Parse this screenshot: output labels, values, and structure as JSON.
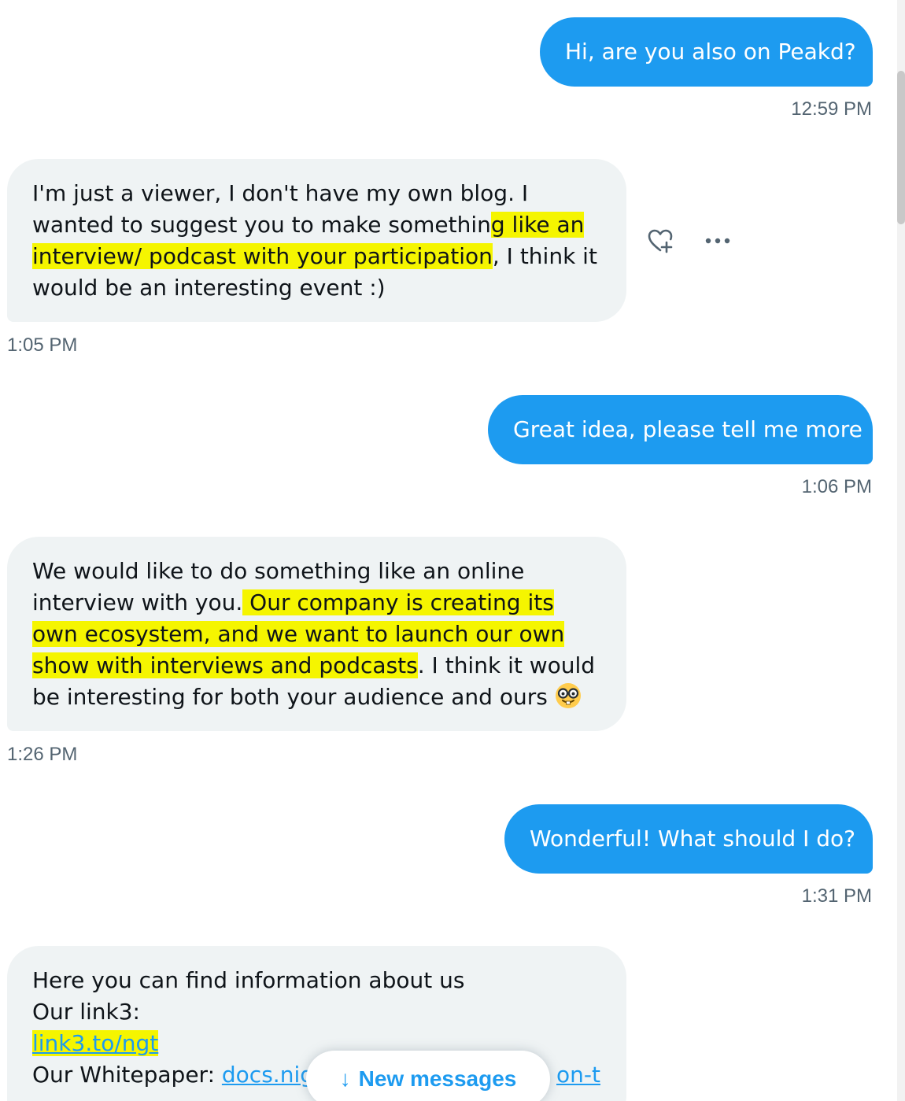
{
  "messages": [
    {
      "type": "sent",
      "text": "Hi, are you also on Peakd?",
      "time": "12:59 PM"
    },
    {
      "type": "received",
      "parts": [
        "I'm just a viewer, I don't have my own blog. I wanted to suggest you to make somethin",
        "g like an interview/ podcast with your participation",
        ", I think it would be an interesting event :)"
      ],
      "time": "1:05 PM"
    },
    {
      "type": "sent",
      "text": "Great idea, please tell me more",
      "time": "1:06 PM"
    },
    {
      "type": "received",
      "parts": [
        "We would like to do something like an online interview with you.",
        " Our company is creating its own ecosystem, and we want to launch our own show with interviews and podcasts",
        ". I think it would be interesting for both your audience and ours"
      ],
      "emoji": "nerd-face-emoji",
      "time": "1:26 PM"
    },
    {
      "type": "sent",
      "text": "Wonderful! What should I do?",
      "time": "1:31 PM"
    },
    {
      "type": "received",
      "line1": "Here you can find information about us",
      "line2": "Our link3:",
      "link3": "link3.to/ngt",
      "whitepaper_label": "Our Whitepaper: ",
      "whitepaper_link_start": "docs.nig",
      "whitepaper_link_end": "on-t"
    }
  ],
  "actions": {
    "react_icon": "heart-plus-icon",
    "more_icon": "more-horizontal-icon"
  },
  "new_messages": {
    "arrow": "↓",
    "label": "New messages"
  },
  "colors": {
    "sent_bubble": "#1d9bf0",
    "received_bubble": "#eff3f4",
    "highlight": "#f5f500",
    "timestamp": "#536471",
    "link": "#1d9bf0"
  }
}
